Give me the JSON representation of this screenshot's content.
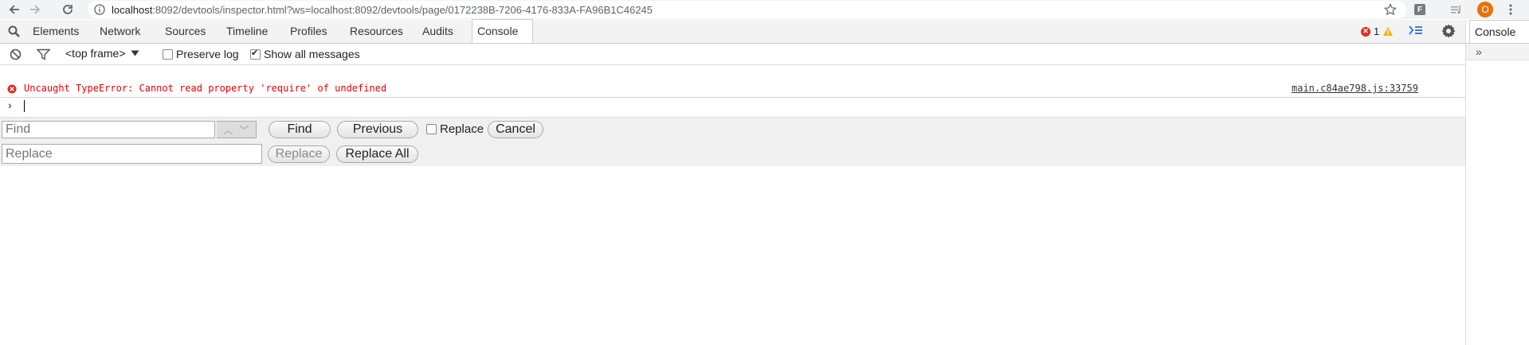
{
  "browser": {
    "url_host": "localhost",
    "url_rest": ":8092/devtools/inspector.html?ws=localhost:8092/devtools/page/0172238B-7206-4176-833A-FA96B1C46245",
    "ext_label": "F",
    "avatar_initial": "O"
  },
  "devtools": {
    "tabs": [
      "Elements",
      "Network",
      "Sources",
      "Timeline",
      "Profiles",
      "Resources",
      "Audits",
      "Console"
    ],
    "selected_tab": "Console",
    "error_count": "1",
    "drawer_tab": "Console",
    "drawer_overflow": "»"
  },
  "console": {
    "context": "<top frame>",
    "preserve_log_label": "Preserve log",
    "preserve_log_checked": false,
    "show_all_label": "Show all messages",
    "show_all_checked": true,
    "error_message": "Uncaught TypeError: Cannot read property 'require' of undefined",
    "error_source": "main.c84ae798.js:33759"
  },
  "findbar": {
    "find_placeholder": "Find",
    "replace_placeholder": "Replace",
    "find_button": "Find",
    "previous_button": "Previous",
    "replace_checkbox_label": "Replace",
    "cancel_button": "Cancel",
    "replace_button": "Replace",
    "replace_all_button": "Replace All"
  },
  "colors": {
    "error_red": "#e00000",
    "avatar_orange": "#e8710a",
    "prompt_blue": "#3367d6"
  }
}
